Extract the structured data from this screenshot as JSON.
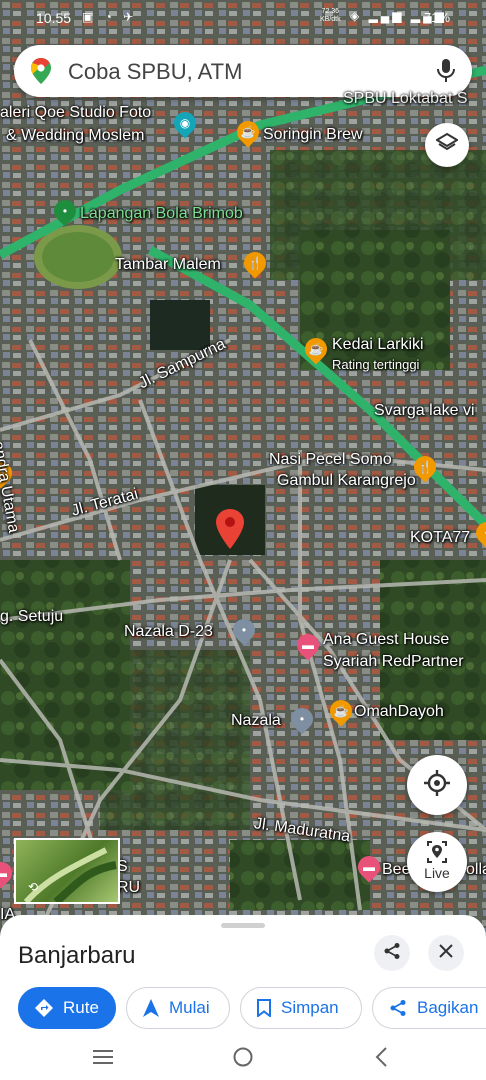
{
  "status_bar": {
    "time": "10.55",
    "left_icons": "▣ ◔ ✈",
    "speed_value": "72.36",
    "speed_unit": "KB/dtk",
    "right_icons": "◈ ▂▄▆ ▂▄▆",
    "battery": "71%"
  },
  "search": {
    "placeholder": "Coba SPBU, ATM",
    "icon_pin": "maps-pin-icon",
    "icon_mic": "mic-icon"
  },
  "map": {
    "labels": {
      "galeri": "aleri Qoe Studio Foto",
      "wedding": "& Wedding Moslem",
      "soringin": "Soringin Brew",
      "spbu": "SPBU Loktabat S",
      "lapangan": "Lapangan Bola Brimob",
      "tambar": "Tambar Malem",
      "kedai": "Kedai Larkiki",
      "kedai_sub": "Rating tertinggi",
      "sampurna": "Jl. Sampurna",
      "svarga": "Svarga lake vi",
      "nasi1": "Nasi Pecel Somo",
      "nasi2": "Gambul Karangrejo",
      "kota": "KOTA77",
      "teratai": "Jl. Teratai",
      "chandra": "andra Utama",
      "setuju": "g. Setuju",
      "nazala_d": "Nazala D-23",
      "ana1": "Ana Guest House",
      "ana2": "Syariah RedPartner",
      "nazala": "Nazala",
      "omah": "OmahDayoh",
      "maduratna": "Jl. Maduratna",
      "bee": "Bee",
      "bee2": "olla",
      "thumb_s": "S",
      "thumb_ru": "RU",
      "edge_ia": "IA"
    },
    "controls": {
      "layers_icon": "layers-icon",
      "locate_icon": "my-location-icon",
      "live_label": "Live"
    }
  },
  "sheet": {
    "title": "Banjarbaru",
    "actions": {
      "route": "Rute",
      "start": "Mulai",
      "save": "Simpan",
      "share": "Bagikan"
    }
  },
  "colors": {
    "accent": "#1a73e8",
    "road": "#3cb371",
    "pin_red": "#ea4335",
    "poi_orange": "#f29900",
    "poi_pink": "#e8527a"
  }
}
